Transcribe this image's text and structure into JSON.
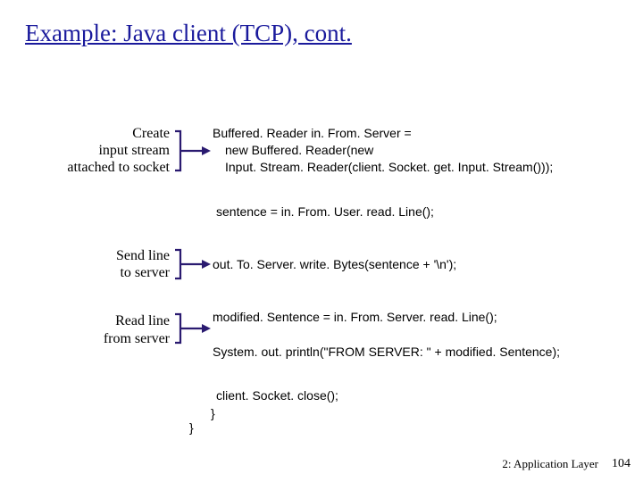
{
  "title": "Example: Java client (TCP), cont.",
  "sections": {
    "createStream": {
      "label": "Create\ninput stream\nattached to socket",
      "code_l1": "Buffered. Reader in. From. Server =",
      "code_l2": "new Buffered. Reader(new",
      "code_l3": "Input. Stream. Reader(client. Socket. get. Input. Stream()));"
    },
    "sentenceRead": {
      "code": "sentence = in. From. User. read. Line();"
    },
    "sendLine": {
      "label": "Send line\nto server",
      "code": "out. To. Server. write. Bytes(sentence + '\\n');"
    },
    "readLine": {
      "label": "Read line\nfrom server",
      "code_l1": "modified. Sentence = in. From. Server. read. Line();",
      "code_l2": "System. out. println(\"FROM SERVER: \" + modified. Sentence);"
    },
    "close": {
      "code": "client. Socket. close();"
    },
    "closebrace1": "}",
    "closebrace2": "}"
  },
  "footer": {
    "chapter": "2: Application Layer",
    "page": "104"
  },
  "colors": {
    "title": "#1a1a9c",
    "arrow": "#2a1a70"
  }
}
